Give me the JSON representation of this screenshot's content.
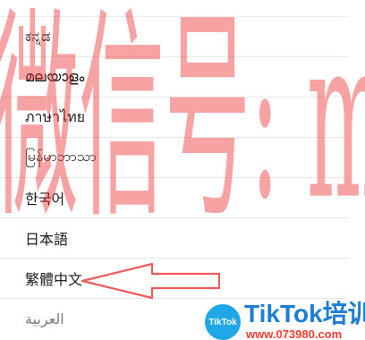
{
  "languages": [
    "ಕನ್ನಡ",
    "മലയാളം",
    "ภาษาไทย",
    "မြန်မာဘာသာ",
    "한국어",
    "日本語",
    "繁體中文",
    "العربية"
  ],
  "watermark": {
    "text": "微信号: muhuanidc",
    "color": "#eb2424"
  },
  "highlight": {
    "language": "繁體中文",
    "arrow_color": "#f05a5a"
  },
  "brand": {
    "logo_text": "TikTok",
    "title": "TikTok培训",
    "url": "www.073980.com",
    "logo_color": "#1fa7e8",
    "title_color": "#1d7ed3",
    "url_color": "#ff3c2f"
  }
}
